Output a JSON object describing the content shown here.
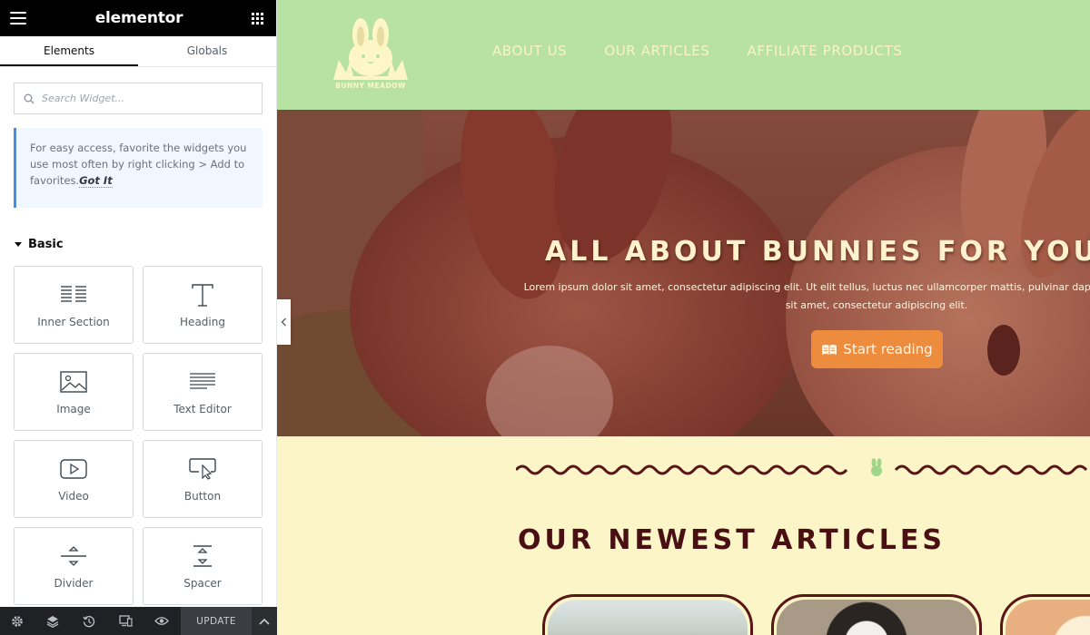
{
  "editor": {
    "logo": "elementor",
    "tabs": [
      {
        "label": "Elements",
        "active": true
      },
      {
        "label": "Globals",
        "active": false
      }
    ],
    "search": {
      "placeholder": "Search Widget..."
    },
    "tip": {
      "text": "For easy access, favorite the widgets you use most often by right clicking > Add to favorites.",
      "link": "Got It"
    },
    "category": "Basic",
    "widgets": [
      {
        "label": "Inner Section",
        "icon": "inner-section-icon"
      },
      {
        "label": "Heading",
        "icon": "heading-icon"
      },
      {
        "label": "Image",
        "icon": "image-icon"
      },
      {
        "label": "Text Editor",
        "icon": "text-editor-icon"
      },
      {
        "label": "Video",
        "icon": "video-icon"
      },
      {
        "label": "Button",
        "icon": "button-icon"
      },
      {
        "label": "Divider",
        "icon": "divider-icon"
      },
      {
        "label": "Spacer",
        "icon": "spacer-icon"
      }
    ],
    "footer": {
      "icons": [
        "settings-icon",
        "layers-icon",
        "history-icon",
        "responsive-icon",
        "preview-eye-icon"
      ],
      "update_label": "UPDATE"
    }
  },
  "site": {
    "brand": "BUNNY MEADOW",
    "nav": [
      "ABOUT US",
      "OUR ARTICLES",
      "AFFILIATE PRODUCTS"
    ],
    "hero": {
      "title": "ALL ABOUT BUNNIES FOR YOUR BUNNY",
      "subtitle": "Lorem ipsum dolor sit amet, consectetur adipiscing elit. Ut elit tellus, luctus nec ullamcorper mattis, pulvinar dapibus leo. Lorem ipsum dolor sit amet, consectetur adipiscing elit.",
      "cta": "Start reading"
    },
    "section_title": "OUR NEWEST ARTICLES"
  },
  "colors": {
    "header_green": "#b8e2a2",
    "cream": "#fbf5c8",
    "maroon": "#4a0f12",
    "cta_orange": "#ee8c3d"
  }
}
